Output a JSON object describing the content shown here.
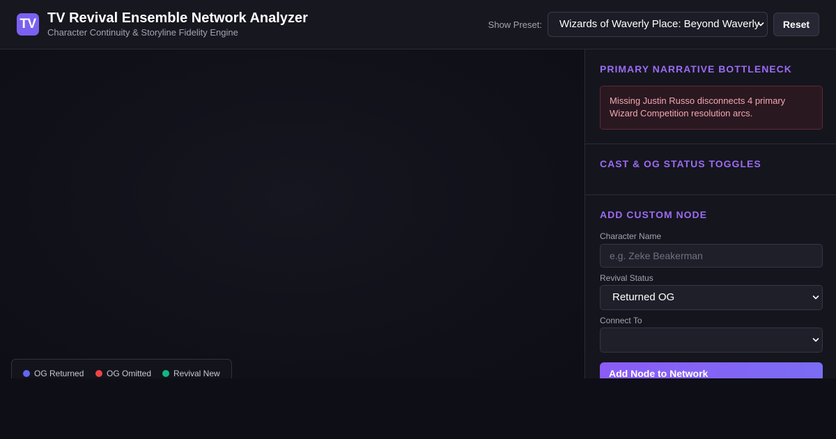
{
  "header": {
    "logo_text": "TV",
    "title": "TV Revival Ensemble Network Analyzer",
    "subtitle": "Character Continuity & Storyline Fidelity Engine",
    "preset_label": "Show Preset:",
    "preset_value": "Wizards of Waverly Place: Beyond Waverly",
    "reset_label": "Reset"
  },
  "legend": {
    "items": [
      {
        "label": "OG Returned",
        "color": "#6366f1"
      },
      {
        "label": "OG Omitted",
        "color": "#ef4444"
      },
      {
        "label": "Revival New",
        "color": "#10b981"
      }
    ]
  },
  "sidebar": {
    "bottleneck": {
      "title": "PRIMARY NARRATIVE BOTTLENECK",
      "message": "Missing Justin Russo disconnects 4 primary Wizard Competition resolution arcs."
    },
    "toggles": {
      "title": "CAST & OG STATUS TOGGLES"
    },
    "add_node": {
      "title": "ADD CUSTOM NODE",
      "name_label": "Character Name",
      "name_placeholder": "e.g. Zeke Beakerman",
      "name_value": "",
      "status_label": "Revival Status",
      "status_value": "Returned OG",
      "connect_label": "Connect To",
      "connect_value": "",
      "submit_label": "Add Node to Network"
    }
  },
  "colors": {
    "accent": "#9b6cf2",
    "brand": "#7b61f0",
    "alert_text": "#f2a7b2"
  }
}
